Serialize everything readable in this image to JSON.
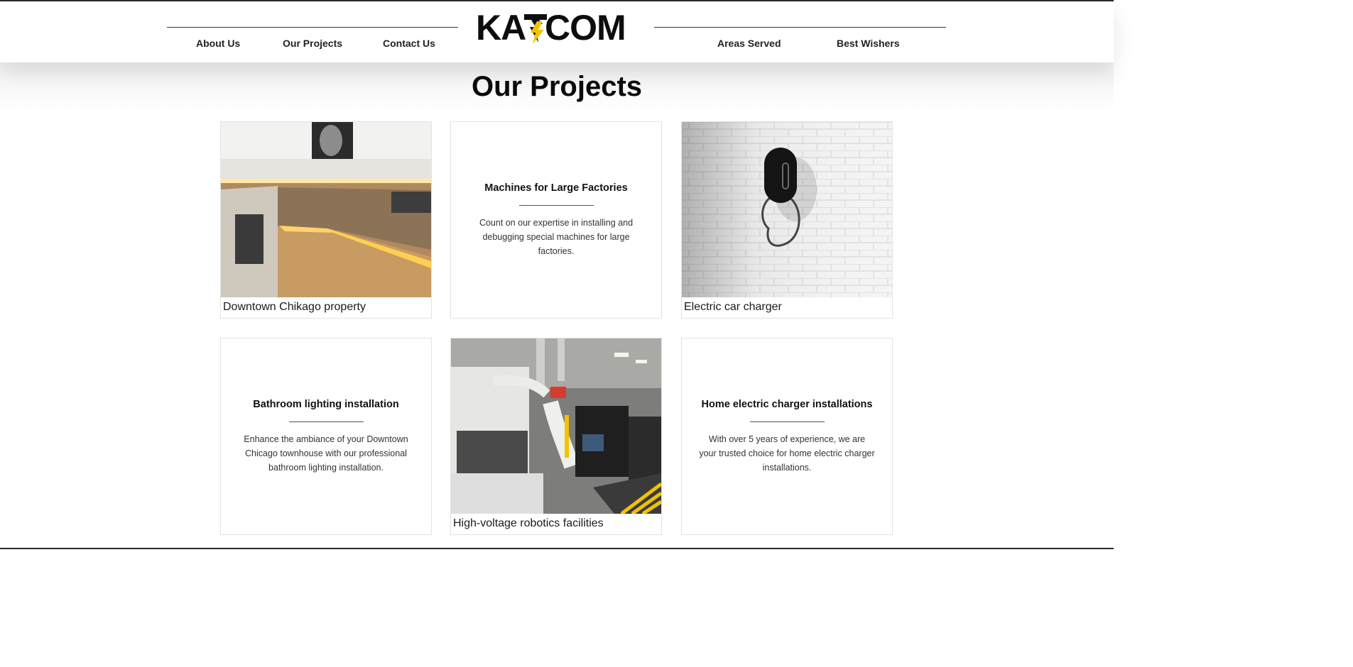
{
  "header": {
    "logo_text": "KATCOM",
    "nav": {
      "about": "About Us",
      "projects": "Our Projects",
      "contact": "Contact Us",
      "areas": "Areas Served",
      "wishers": "Best Wishers"
    }
  },
  "main": {
    "title": "Our Projects",
    "cards": [
      {
        "caption": "Downtown Chikago property",
        "image": "kitchen-photo"
      },
      {
        "title": "Machines for Large Factories",
        "body": "Count on our expertise in installing and debugging special machines for large factories."
      },
      {
        "caption": "Electric car charger",
        "image": "ev-charger-photo"
      },
      {
        "title": "Bathroom lighting installation",
        "body": "Enhance the ambiance of your Downtown Chicago townhouse with our professional bathroom lighting installation."
      },
      {
        "caption": "High-voltage robotics facilities",
        "image": "robotics-photo"
      },
      {
        "title": "Home electric charger installations",
        "body": "With over 5 years of experience, we are your trusted choice for home electric charger installations."
      }
    ]
  },
  "colors": {
    "accent": "#f2c200",
    "text": "#111111",
    "border": "#e3e3e3"
  }
}
